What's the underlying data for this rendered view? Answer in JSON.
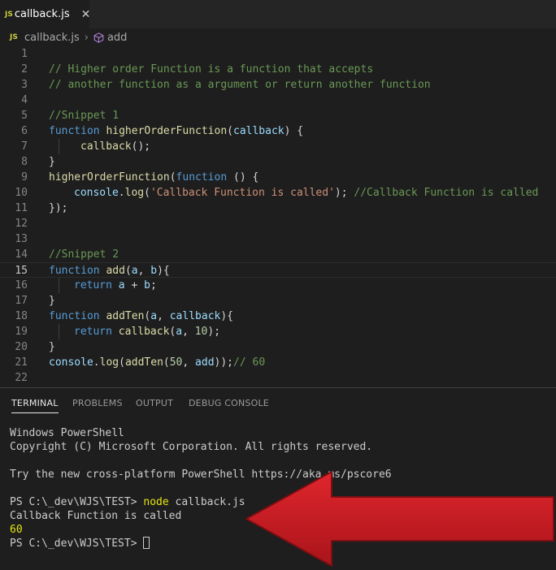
{
  "tab": {
    "badge": "JS",
    "label": "callback.js",
    "close": "✕"
  },
  "breadcrumb": {
    "badge": "JS",
    "file": "callback.js",
    "sep": "›",
    "symbol": "add"
  },
  "editor": {
    "active_line": 15,
    "line_numbers": [
      "1",
      "2",
      "3",
      "4",
      "5",
      "6",
      "7",
      "8",
      "9",
      "10",
      "11",
      "12",
      "13",
      "14",
      "15",
      "16",
      "17",
      "18",
      "19",
      "20",
      "21",
      "22"
    ],
    "lines": {
      "l2": "// Higher order Function is a function that accepts",
      "l3": "// another function as a argument or return another function",
      "l5": "//Snippet 1",
      "l6": {
        "kw": "function",
        "fn": "higherOrderFunction",
        "o": "(",
        "param": "callback",
        "c": ") {"
      },
      "l7": {
        "fn": "callback",
        "rest": "();"
      },
      "l8": "}",
      "l9": {
        "fn": "higherOrderFunction",
        "o": "(",
        "kw": "function",
        "rest": " () {"
      },
      "l10": {
        "obj": "console",
        "dot": ".",
        "fn": "log",
        "o": "(",
        "str": "'Callback Function is called'",
        "c": "); ",
        "cm": "//Callback Function is called"
      },
      "l11": "});",
      "l14": "//Snippet 2",
      "l15": {
        "kw": "function",
        "fn": "add",
        "o": "(",
        "a": "a",
        "comma": ", ",
        "b": "b",
        "c": "){"
      },
      "l16": {
        "kw": "return",
        "a": "a",
        "op": " + ",
        "b": "b",
        "end": ";"
      },
      "l17": "}",
      "l18": {
        "kw": "function",
        "fn": "addTen",
        "o": "(",
        "a": "a",
        "comma": ", ",
        "cb": "callback",
        "c": "){"
      },
      "l19": {
        "kw": "return",
        "fn": "callback",
        "o": "(",
        "a": "a",
        "comma": ", ",
        "num": "10",
        "c": ");"
      },
      "l20": "}",
      "l21": {
        "obj": "console",
        "dot": ".",
        "fn": "log",
        "o": "(",
        "fn2": "addTen",
        "o2": "(",
        "num": "50",
        "comma": ", ",
        "arg": "add",
        "c": "));",
        "cm": "// 60"
      }
    }
  },
  "panel": {
    "tabs": [
      "TERMINAL",
      "PROBLEMS",
      "OUTPUT",
      "DEBUG CONSOLE"
    ],
    "active_tab": "TERMINAL"
  },
  "terminal": {
    "line1": "Windows PowerShell",
    "line2": "Copyright (C) Microsoft Corporation. All rights reserved.",
    "line4": "Try the new cross-platform PowerShell https://aka.ms/pscore6",
    "prompt1": "PS C:\\_dev\\WJS\\TEST> ",
    "cmd": "node",
    "cmd_arg": " callback.js",
    "out1": "Callback Function is called",
    "out2": "60",
    "prompt2": "PS C:\\_dev\\WJS\\TEST> "
  },
  "colors": {
    "background": "#1e1e1e",
    "comment": "#6a9955",
    "keyword": "#569cd6",
    "function": "#dcdcaa",
    "parameter": "#9cdcfe",
    "string": "#ce9178",
    "number": "#b5cea8",
    "arrow": "#d92128"
  },
  "icons": {
    "tab_close": "close-icon",
    "symbol": "cube-icon",
    "annotation": "red-arrow-icon"
  }
}
